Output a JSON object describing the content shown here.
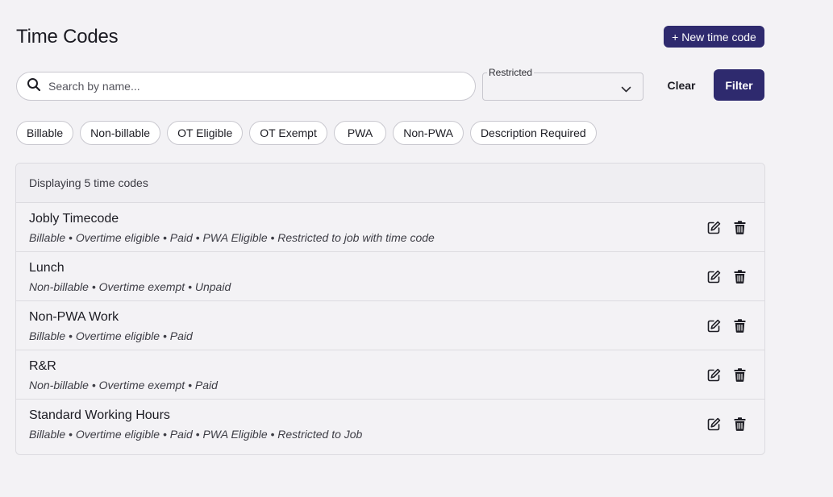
{
  "header": {
    "title": "Time Codes",
    "new_button_label": "+ New time code"
  },
  "search": {
    "placeholder": "Search by name...",
    "value": ""
  },
  "restricted_select": {
    "label": "Restricted",
    "value": ""
  },
  "actions": {
    "clear_label": "Clear",
    "filter_label": "Filter"
  },
  "chips": [
    {
      "label": "Billable"
    },
    {
      "label": "Non-billable"
    },
    {
      "label": "OT Eligible"
    },
    {
      "label": "OT Exempt"
    },
    {
      "label": "PWA"
    },
    {
      "label": "Non-PWA"
    },
    {
      "label": "Description Required"
    }
  ],
  "list": {
    "summary": "Displaying 5 time codes",
    "items": [
      {
        "name": "Jobly Timecode",
        "description": "Billable • Overtime eligible • Paid • PWA Eligible • Restricted to job with time code"
      },
      {
        "name": "Lunch",
        "description": "Non-billable • Overtime exempt • Unpaid"
      },
      {
        "name": "Non-PWA Work",
        "description": "Billable • Overtime eligible • Paid"
      },
      {
        "name": "R&R",
        "description": "Non-billable • Overtime exempt • Paid"
      },
      {
        "name": "Standard Working Hours",
        "description": "Billable • Overtime eligible • Paid • PWA Eligible • Restricted to Job"
      }
    ]
  },
  "icons": {
    "search": "search-icon",
    "select": "chevron-down-icon",
    "edit": "edit-icon",
    "delete": "trash-icon"
  },
  "colors": {
    "primary": "#2e2a6e",
    "background": "#f3f2f5"
  }
}
